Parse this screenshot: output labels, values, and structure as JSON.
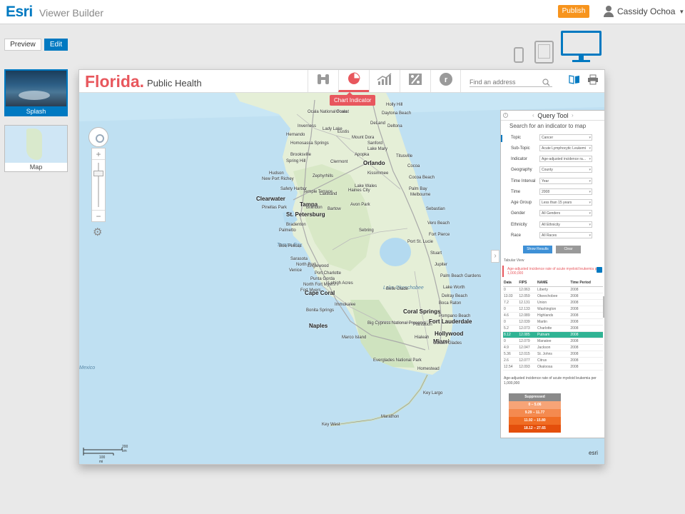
{
  "topbar": {
    "brand": "Esri",
    "app_name": "Viewer Builder",
    "publish_label": "Publish",
    "user_name": "Cassidy Ochoa"
  },
  "mode": {
    "preview_label": "Preview",
    "edit_label": "Edit"
  },
  "pages": [
    {
      "label": "Splash"
    },
    {
      "label": "Map"
    }
  ],
  "app": {
    "title": "Florida.",
    "subtitle": "Public Health",
    "tooltip": "Chart Indicator",
    "address_placeholder": "Find an address"
  },
  "map": {
    "water_labels": [
      "Tampa Bay",
      "Lake Okeechobee",
      "Mexico"
    ],
    "cities": [
      {
        "name": "Ocala National Forest"
      },
      {
        "name": "Ocala"
      },
      {
        "name": "Daytona Beach"
      },
      {
        "name": "Holly Hill"
      },
      {
        "name": "Hernando"
      },
      {
        "name": "Inverness"
      },
      {
        "name": "Lady Lake"
      },
      {
        "name": "Eustis"
      },
      {
        "name": "DeLand"
      },
      {
        "name": "Deltona"
      },
      {
        "name": "Mount Dora"
      },
      {
        "name": "Sanford"
      },
      {
        "name": "Lake Mary"
      },
      {
        "name": "Homosassa Springs"
      },
      {
        "name": "Brooksville"
      },
      {
        "name": "Clermont"
      },
      {
        "name": "Apopka"
      },
      {
        "name": "Orlando"
      },
      {
        "name": "Titusville"
      },
      {
        "name": "Spring Hill"
      },
      {
        "name": "Kissimmee"
      },
      {
        "name": "Lake Wales"
      },
      {
        "name": "Cocoa"
      },
      {
        "name": "Cocoa Beach"
      },
      {
        "name": "Hudson"
      },
      {
        "name": "New Port Richey"
      },
      {
        "name": "Zephyrhills"
      },
      {
        "name": "Lakeland"
      },
      {
        "name": "Haines City"
      },
      {
        "name": "Palm Bay"
      },
      {
        "name": "Melbourne"
      },
      {
        "name": "Tampa",
        "big": true
      },
      {
        "name": "Clearwater",
        "big": true
      },
      {
        "name": "Safety Harbor"
      },
      {
        "name": "Temple Terrace"
      },
      {
        "name": "Brandon"
      },
      {
        "name": "St. Petersburg",
        "big": true
      },
      {
        "name": "Pinellas Park"
      },
      {
        "name": "Bartow"
      },
      {
        "name": "Avon Park"
      },
      {
        "name": "Sebring"
      },
      {
        "name": "Sebastian"
      },
      {
        "name": "Vero Beach"
      },
      {
        "name": "Bradenton"
      },
      {
        "name": "Palmetto"
      },
      {
        "name": "Fort Pierce"
      },
      {
        "name": "Port St. Lucie"
      },
      {
        "name": "Stuart"
      },
      {
        "name": "Boe Pelicas"
      },
      {
        "name": "Sarasota"
      },
      {
        "name": "North Port"
      },
      {
        "name": "Venice"
      },
      {
        "name": "Englewood"
      },
      {
        "name": "Port Charlotte"
      },
      {
        "name": "Punta Gorda"
      },
      {
        "name": "Jupiter"
      },
      {
        "name": "Palm Beach Gardens"
      },
      {
        "name": "North Fort Myers"
      },
      {
        "name": "Fort Myers"
      },
      {
        "name": "Cape Coral",
        "big": true
      },
      {
        "name": "Lehigh Acres"
      },
      {
        "name": "Belle Glade"
      },
      {
        "name": "Lake Worth"
      },
      {
        "name": "Boca Raton"
      },
      {
        "name": "Delray Beach"
      },
      {
        "name": "Bonita Springs"
      },
      {
        "name": "Immokalee"
      },
      {
        "name": "Coral Springs",
        "big": true
      },
      {
        "name": "Pompano Beach"
      },
      {
        "name": "Naples",
        "big": true
      },
      {
        "name": "Plantation"
      },
      {
        "name": "Fort Lauderdale",
        "big": true
      },
      {
        "name": "Hollywood",
        "big": true
      },
      {
        "name": "Marco Island"
      },
      {
        "name": "Big Cypress National Preserve"
      },
      {
        "name": "Hialeah"
      },
      {
        "name": "Miami",
        "big": true
      },
      {
        "name": "Homestead"
      },
      {
        "name": "Everglades National Park"
      },
      {
        "name": "Key Largo"
      },
      {
        "name": "Marathon"
      },
      {
        "name": "Key West"
      },
      {
        "name": "Golden Glades"
      }
    ],
    "scale_top": "200 km",
    "scale_bottom": "100 mi",
    "attribution": "esri"
  },
  "query_tool": {
    "title": "Query Tool",
    "subtitle": "Search for an indicator to map",
    "fields": [
      {
        "label": "Topic",
        "value": "Cancer"
      },
      {
        "label": "Sub-Topic",
        "value": "Acute Lymphocytic Leukemi"
      },
      {
        "label": "Indicator",
        "value": "Age-adjusted incidence ra..."
      },
      {
        "label": "Geography",
        "value": "County"
      },
      {
        "label": "Time Interval",
        "value": "Year"
      },
      {
        "label": "Time",
        "value": "2008"
      },
      {
        "label": "Age Group",
        "value": "Less than 15 years"
      },
      {
        "label": "Gender",
        "value": "All Genders"
      },
      {
        "label": "Ethnicity",
        "value": "All Ethnicity"
      },
      {
        "label": "Race",
        "value": "All Races"
      }
    ],
    "show_results": "Show Results",
    "clear": "Clear",
    "tabular_view": "Tabular View",
    "indicator_note": "Age-adjusted incidence rate of acute myeloid leukemia per 1,000,000",
    "table": {
      "headers": [
        "Data",
        "FIPS",
        "NAME",
        "Time Period"
      ],
      "rows": [
        [
          "0",
          "12.063",
          "Liberty",
          "2008"
        ],
        [
          "13.03",
          "12.059",
          "Okeechobee",
          "2008"
        ],
        [
          "7.2",
          "12.131",
          "Union",
          "2008"
        ],
        [
          "0",
          "12.133",
          "Washington",
          "2008"
        ],
        [
          "4.6",
          "12.089",
          "Highlands",
          "2008"
        ],
        [
          "0",
          "12.039",
          "Martin",
          "2008"
        ],
        [
          "5.2",
          "12.073",
          "Charlotte",
          "2008"
        ],
        [
          "8.12",
          "12.085",
          "Putnam",
          "2008"
        ],
        [
          "0",
          "12.079",
          "Manatee",
          "2008"
        ],
        [
          "4.9",
          "12.047",
          "Jackson",
          "2008"
        ],
        [
          "5.36",
          "12.015",
          "St. Johns",
          "2008"
        ],
        [
          "2.6",
          "12.077",
          "Citrus",
          "2008"
        ],
        [
          "12.54",
          "12.093",
          "Okaloosa",
          "2008"
        ]
      ],
      "highlight_index": 7
    },
    "caption": "Age-adjusted incidence rate of acute myeloid leukemia per 1,000,000",
    "legend": [
      {
        "label": "Suppressed",
        "color": "#8a8a8a"
      },
      {
        "label": "0 – 5.06",
        "color": "#f7a477"
      },
      {
        "label": "9.29 – 11.77",
        "color": "#f48a4f"
      },
      {
        "label": "11.92 – 15.80",
        "color": "#f06d24"
      },
      {
        "label": "18.12 – 27.65",
        "color": "#e44f0c"
      }
    ]
  }
}
